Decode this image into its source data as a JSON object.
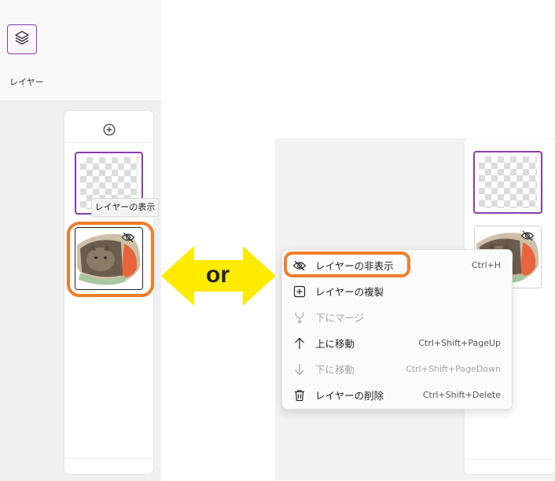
{
  "left_panel": {
    "layers_label": "レイヤー",
    "tooltip": "レイヤーの表示"
  },
  "arrow": {
    "text": "or",
    "color": "#ffeb00"
  },
  "context_menu": {
    "items": [
      {
        "label": "レイヤーの非表示",
        "shortcut": "Ctrl+H",
        "icon": "eye-off-icon",
        "disabled": false
      },
      {
        "label": "レイヤーの複製",
        "shortcut": "",
        "icon": "duplicate-icon",
        "disabled": false
      },
      {
        "label": "下にマージ",
        "shortcut": "",
        "icon": "merge-down-icon",
        "disabled": true
      },
      {
        "label": "上に移動",
        "shortcut": "Ctrl+Shift+PageUp",
        "icon": "arrow-up-icon",
        "disabled": false
      },
      {
        "label": "下に移動",
        "shortcut": "Ctrl+Shift+PageDown",
        "icon": "arrow-down-icon",
        "disabled": true
      },
      {
        "label": "レイヤーの削除",
        "shortcut": "Ctrl+Shift+Delete",
        "icon": "trash-icon",
        "disabled": false
      }
    ]
  },
  "colors": {
    "selection": "#8a3bb0",
    "highlight": "#ef7d2a"
  }
}
